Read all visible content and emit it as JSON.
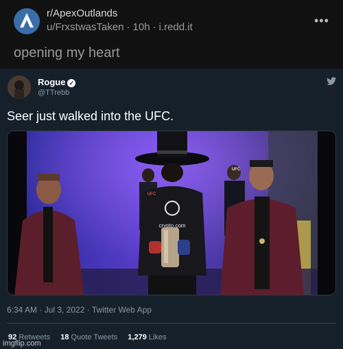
{
  "reddit": {
    "subreddit": "r/ApexOutlands",
    "author": "u/FrxstwasTaken",
    "age": "10h",
    "domain": "i.redd.it",
    "title": "opening my heart"
  },
  "tweet": {
    "name": "Rogue",
    "handle": "@TTrebb",
    "text": "Seer just walked into the UFC.",
    "media_text": {
      "ufc_left": "UFC",
      "ufc_right": "UFC",
      "sponsor": "crypto.com"
    },
    "timestamp": "6:34 AM · Jul 3, 2022 · Twitter Web App",
    "retweets_count": "92",
    "retweets_label": "Retweets",
    "quotes_count": "18",
    "quotes_label": "Quote Tweets",
    "likes_count": "1,279",
    "likes_label": "Likes"
  },
  "watermark": "imgflip.com",
  "colors": {
    "reddit_bg": "#111111",
    "tweet_bg": "#15202b",
    "subreddit_icon": "#3a6ea8"
  },
  "icons": [
    "apex-subreddit-icon",
    "more-options-icon",
    "verified-icon",
    "twitter-icon"
  ]
}
